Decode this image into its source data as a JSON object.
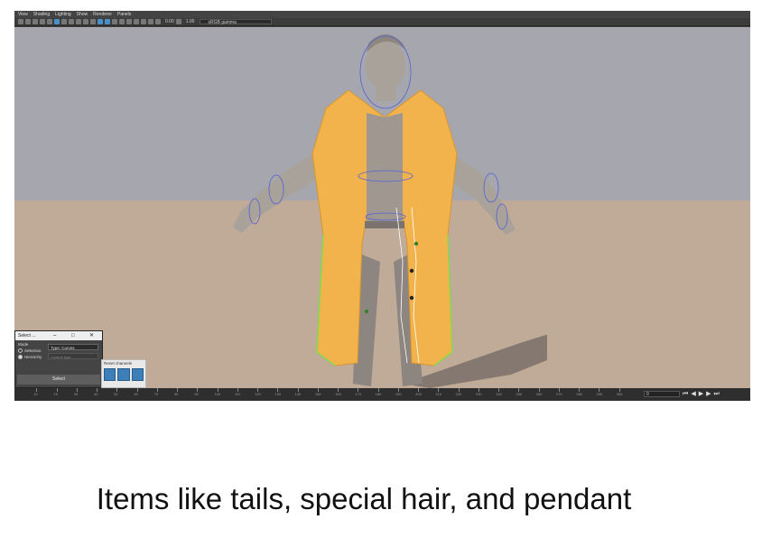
{
  "menu": [
    "View",
    "Shading",
    "Lighting",
    "Show",
    "Renderer",
    "Panels"
  ],
  "toolbar": {
    "value_a": "0.00",
    "value_b": "1.00",
    "colorspace": "sRGB gamma"
  },
  "timeline": {
    "ticks": [
      "10",
      "20",
      "30",
      "40",
      "50",
      "60",
      "70",
      "80",
      "90",
      "100",
      "110",
      "120",
      "130",
      "140",
      "150",
      "160",
      "170",
      "180",
      "190",
      "200",
      "210",
      "220",
      "230",
      "240",
      "250",
      "260",
      "270",
      "280",
      "290",
      "300"
    ],
    "current_frame": "0"
  },
  "dialog": {
    "title": "Select ...",
    "mode_label": "Mode",
    "mode_options": [
      "Selection",
      "Hierarchy"
    ],
    "type_label": "Type",
    "type_value": "Curves",
    "custom_placeholder": "Custom type",
    "select_label": "Select"
  },
  "shelf": {
    "label": "Reset channels"
  },
  "caption": "Items like tails, special hair, and pendant",
  "colors": {
    "coat": "#f2b34c",
    "rig": "#7ae04a",
    "controls": "#5560d8",
    "sky": "#a6a7ae",
    "ground": "#c0aa98"
  }
}
